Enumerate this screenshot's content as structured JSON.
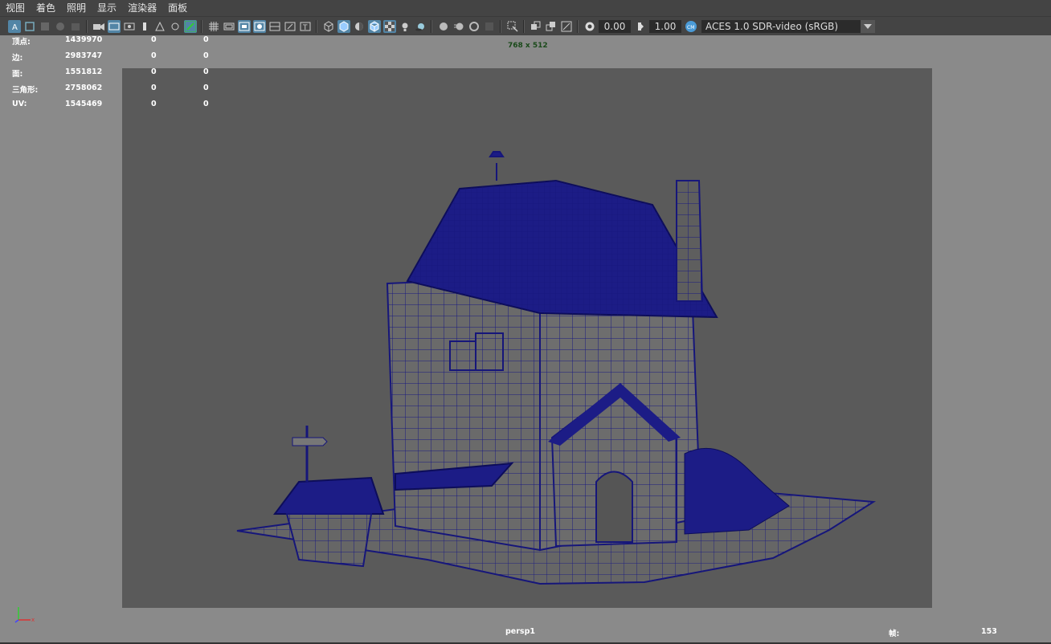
{
  "menu": [
    "视图",
    "着色",
    "照明",
    "显示",
    "渲染器",
    "面板"
  ],
  "toolbar": {
    "exposure": "0.00",
    "gamma": "1.00",
    "color_space": "ACES 1.0 SDR-video (sRGB)"
  },
  "viewport": {
    "resolution": "768 x 512",
    "camera": "persp1",
    "frame_label": "帧:",
    "frame_value": "153"
  },
  "stats": [
    {
      "label": "顶点:",
      "total": "1439970",
      "sel": "0",
      "extra": "0"
    },
    {
      "label": "边:",
      "total": "2983747",
      "sel": "0",
      "extra": "0"
    },
    {
      "label": "面:",
      "total": "1551812",
      "sel": "0",
      "extra": "0"
    },
    {
      "label": "三角形:",
      "total": "2758062",
      "sel": "0",
      "extra": "0"
    },
    {
      "label": "UV:",
      "total": "1545469",
      "sel": "0",
      "extra": "0"
    }
  ],
  "colors": {
    "wire": "#16167a",
    "accent": "#5285a6",
    "gate": "#5a5a5a",
    "bg": "#8a8a8a"
  }
}
